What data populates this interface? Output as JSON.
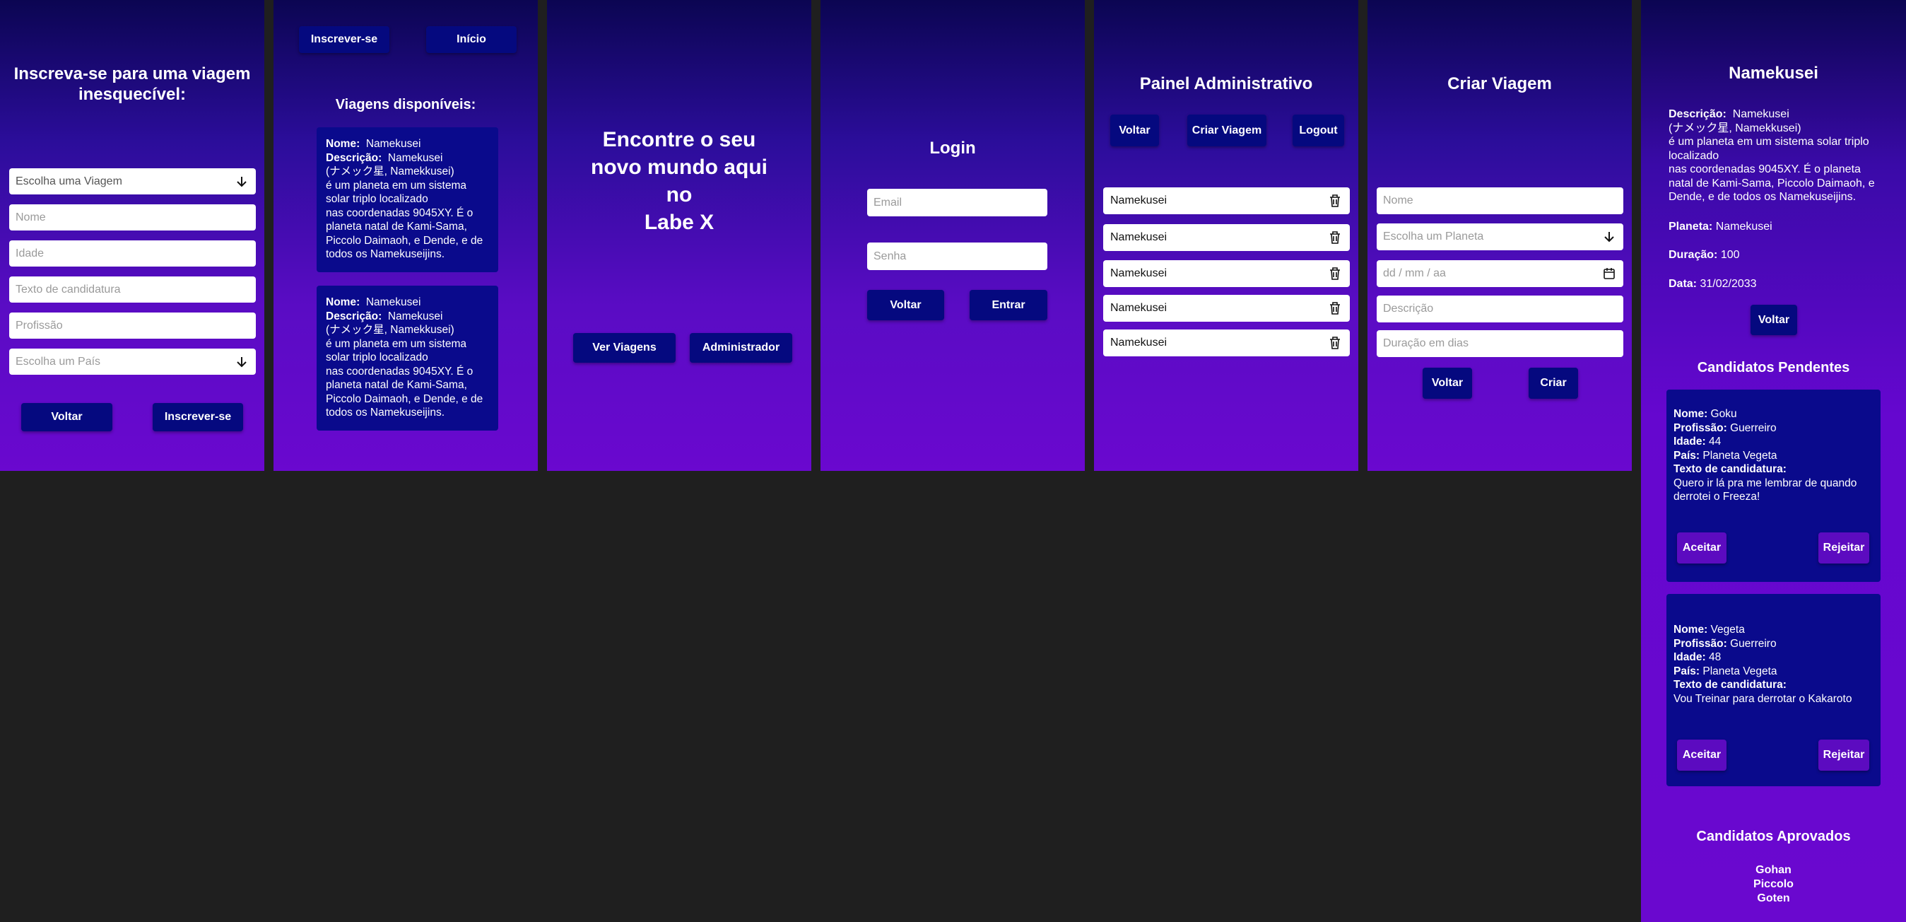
{
  "colors": {
    "page_bg": "#1f1f1f",
    "button": "#05097f",
    "card": "#0a0a8c",
    "accent_purple": "#5c0bc0"
  },
  "signup": {
    "title": "Inscreva-se para uma viagem inesquecível:",
    "trip_select": "Escolha uma Viagem",
    "name_placeholder": "Nome",
    "age_placeholder": "Idade",
    "text_placeholder": "Texto de candidatura",
    "profession_placeholder": "Profissão",
    "country_select": "Escolha um País",
    "back": "Voltar",
    "submit": "Inscrever-se"
  },
  "trips": {
    "signup_btn": "Inscrever-se",
    "home_btn": "Início",
    "title": "Viagens disponíveis:",
    "cards": [
      {
        "name_label": "Nome:",
        "name": "Namekusei",
        "desc_label": "Descrição:",
        "desc_first": "Namekusei",
        "desc_rest": "(ナメック星, Namekkusei)\n é um planeta em um sistema solar triplo localizado\nnas coordenadas 9045XY. É o planeta natal de Kami-Sama, Piccolo Daimaoh, e Dende, e de todos os Namekuseijins."
      },
      {
        "name_label": "Nome:",
        "name": "Namekusei",
        "desc_label": "Descrição:",
        "desc_first": "Namekusei",
        "desc_rest": "(ナメック星, Namekkusei)\n é um planeta em um sistema solar triplo localizado\nnas coordenadas 9045XY. É o planeta natal de Kami-Sama, Piccolo Daimaoh, e Dende, e de todos os Namekuseijins."
      }
    ]
  },
  "home": {
    "headline_line1": "Encontre o seu",
    "headline_line2": "novo mundo aqui",
    "headline_line3": "no",
    "headline_line4": "Labe X",
    "view_trips": "Ver Viagens",
    "admin": "Administrador"
  },
  "login": {
    "title": "Login",
    "email_placeholder": "Email",
    "password_placeholder": "Senha",
    "back": "Voltar",
    "enter": "Entrar"
  },
  "admin": {
    "title": "Painel Administrativo",
    "back": "Voltar",
    "create": "Criar Viagem",
    "logout": "Logout",
    "trips": [
      "Namekusei",
      "Namekusei",
      "Namekusei",
      "Namekusei",
      "Namekusei"
    ]
  },
  "create": {
    "title": "Criar Viagem",
    "name_placeholder": "Nome",
    "planet_select": "Escolha um Planeta",
    "date_placeholder": "dd / mm / aa",
    "desc_placeholder": "Descrição",
    "duration_placeholder": "Duração em dias",
    "back": "Voltar",
    "create": "Criar"
  },
  "detail": {
    "title": "Namekusei",
    "desc_label": "Descrição:",
    "desc_text": "Namekusei\n(ナメック星, Namekkusei)\n é um planeta em um sistema solar triplo localizado\nnas coordenadas 9045XY. É o planeta natal de Kami-Sama, Piccolo Daimaoh, e Dende, e de todos os Namekuseijins.",
    "planet_label": "Planeta:",
    "planet": "Namekusei",
    "duration_label": "Duração:",
    "duration": "100",
    "date_label": "Data:",
    "date": "31/02/2033",
    "back": "Voltar",
    "pending_title": "Candidatos Pendentes",
    "candidates": [
      {
        "name": "Goku",
        "profession": "Guerreiro",
        "age": "44",
        "country": "Planeta Vegeta",
        "text": "Quero ir lá pra me lembrar de quando derrotei o Freeza!"
      },
      {
        "name": "Vegeta",
        "profession": "Guerreiro",
        "age": "48",
        "country": "Planeta Vegeta",
        "text": "Vou Treinar para derrotar o Kakaroto"
      }
    ],
    "labels": {
      "name": "Nome:",
      "profession": "Profissão:",
      "age": "Idade:",
      "country": "País:",
      "text": "Texto de candidatura:"
    },
    "accept": "Aceitar",
    "reject": "Rejeitar",
    "approved_title": "Candidatos Aprovados",
    "approved": [
      "Gohan",
      "Piccolo",
      "Goten"
    ]
  },
  "icons": [
    "arrow-down-icon",
    "trash-icon",
    "calendar-icon"
  ]
}
